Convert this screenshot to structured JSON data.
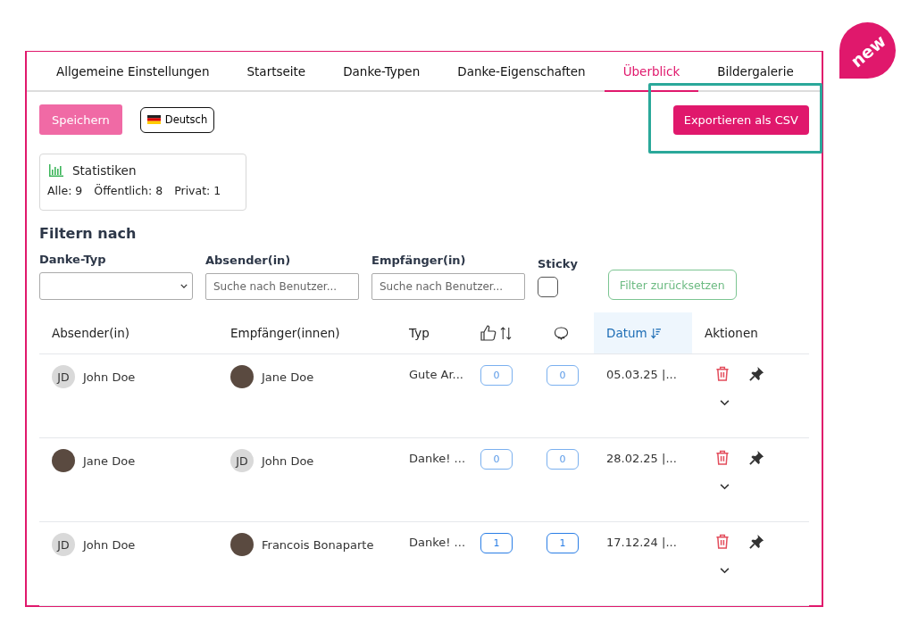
{
  "badge": {
    "label": "new"
  },
  "tabs": [
    {
      "label": "Allgemeine Einstellungen",
      "selected": false
    },
    {
      "label": "Startseite",
      "selected": false
    },
    {
      "label": "Danke-Typen",
      "selected": false
    },
    {
      "label": "Danke-Eigenschaften",
      "selected": false
    },
    {
      "label": "Überblick",
      "selected": true
    },
    {
      "label": "Bildergalerie",
      "selected": false
    }
  ],
  "toolbar": {
    "save_button": "Speichern",
    "language": "Deutsch",
    "export_button": "Exportieren als CSV",
    "export_highlighted": true
  },
  "stats": {
    "title": "Statistiken",
    "items": [
      "Alle: 9",
      "Öffentlich: 8",
      "Privat: 1"
    ]
  },
  "filters": {
    "heading": "Filtern nach",
    "fields": [
      {
        "kind": "select",
        "label": "Danke-Typ"
      },
      {
        "kind": "text",
        "label": "Absender(in)",
        "placeholder": "Suche nach Benutzer..."
      },
      {
        "kind": "text",
        "label": "Empfänger(in)",
        "placeholder": "Suche nach Benutzer..."
      },
      {
        "kind": "checkbox",
        "label": "Sticky",
        "checked": false
      }
    ],
    "reset_button": "Filter zurücksetzen"
  },
  "table": {
    "columns": [
      {
        "kind": "text",
        "label": "Absender(in)",
        "selected": false
      },
      {
        "kind": "text",
        "label": "Empfänger(innen)",
        "selected": false
      },
      {
        "kind": "text",
        "label": "Typ",
        "selected": false
      },
      {
        "kind": "likes",
        "selected": false
      },
      {
        "kind": "comments",
        "selected": false
      },
      {
        "kind": "text",
        "label": "Datum",
        "selected": true
      },
      {
        "kind": "text",
        "label": "Aktionen",
        "selected": false
      }
    ],
    "rows": [
      {
        "sender": {
          "name": "John Doe",
          "kind": "initials",
          "initials": "JD"
        },
        "recipient": {
          "name": "Jane Doe",
          "kind": "photo"
        },
        "type": "Gute Ar...",
        "likes": "0",
        "comments": "0",
        "date": "05.03.25 |..."
      },
      {
        "sender": {
          "name": "Jane Doe",
          "kind": "photo"
        },
        "recipient": {
          "name": "John Doe",
          "kind": "initials",
          "initials": "JD"
        },
        "type": "Danke! ...",
        "likes": "0",
        "comments": "0",
        "date": "28.02.25 |..."
      },
      {
        "sender": {
          "name": "John Doe",
          "kind": "initials",
          "initials": "JD"
        },
        "recipient": {
          "name": "Francois Bonaparte",
          "kind": "photo"
        },
        "type": "Danke! ...",
        "likes": "1",
        "comments": "1",
        "date": "17.12.24 |..."
      }
    ]
  }
}
